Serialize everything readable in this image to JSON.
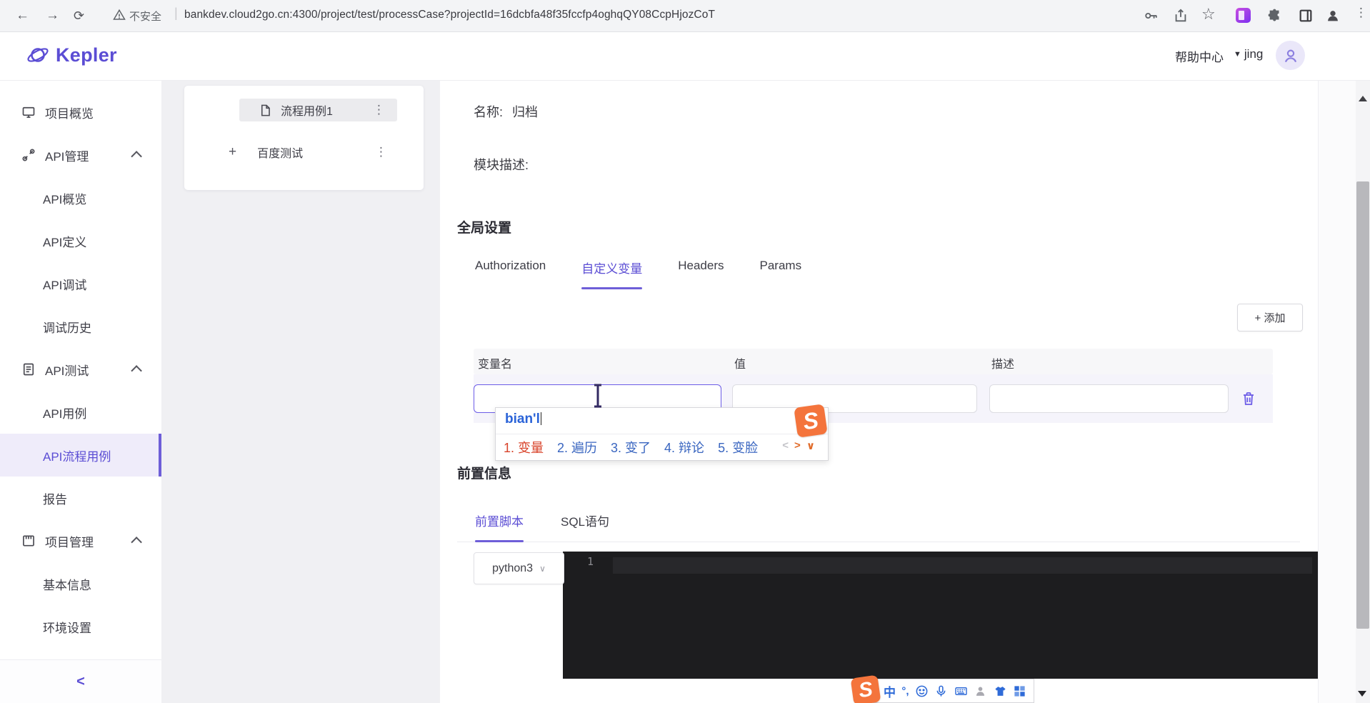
{
  "browser": {
    "security_warning": "不安全",
    "url": "bankdev.cloud2go.cn:4300/project/test/processCase?projectId=16dcbfa48f35fccfp4oghqQY08CcpHjozCoT"
  },
  "header": {
    "brand": "Kepler",
    "help_center": "帮助中心",
    "username": "jing"
  },
  "sidebar": {
    "items": [
      {
        "label": "项目概览"
      },
      {
        "label": "API管理"
      },
      {
        "label": "API概览"
      },
      {
        "label": "API定义"
      },
      {
        "label": "API调试"
      },
      {
        "label": "调试历史"
      },
      {
        "label": "API测试"
      },
      {
        "label": "API用例"
      },
      {
        "label": "API流程用例"
      },
      {
        "label": "报告"
      },
      {
        "label": "项目管理"
      },
      {
        "label": "基本信息"
      },
      {
        "label": "环境设置"
      }
    ],
    "collapse_label": "<"
  },
  "tree": {
    "items": [
      {
        "label": "流程用例1"
      },
      {
        "label": "百度测试"
      }
    ]
  },
  "form": {
    "name_label": "名称:",
    "name_value": "归档",
    "module_desc_label": "模块描述:"
  },
  "global_settings": {
    "title": "全局设置",
    "tabs": [
      "Authorization",
      "自定义变量",
      "Headers",
      "Params"
    ],
    "add_button": "+ 添加",
    "table_headers": [
      "变量名",
      "值",
      "描述"
    ]
  },
  "ime": {
    "composition": "bian'l",
    "candidates": [
      "1. 变量",
      "2. 遍历",
      "3. 变了",
      "4. 辩论",
      "5. 变脸"
    ]
  },
  "pre_info": {
    "title": "前置信息",
    "tabs": [
      "前置脚本",
      "SQL语句"
    ],
    "language": "python3",
    "editor_line_number": "1"
  },
  "icons": {
    "back": "←",
    "forward": "→",
    "reload": "⟳",
    "url_divider": "|",
    "star": "☆",
    "more_vert": "⋮",
    "menu_dots": "⋮",
    "caret_down": "▼",
    "expand_plus": "+",
    "chevron_down": "∨",
    "cand_prev": "<",
    "cand_next": ">",
    "cand_expand": "∨",
    "ime_mode": "中",
    "ime_punct": "°,",
    "sogou_s": "S"
  },
  "colors": {
    "brand_purple": "#5b4dd4",
    "active_item_bg": "#efecfa",
    "focus_border": "#6c5ce7",
    "sogou_orange": "#f4743c",
    "candidate_blue": "#3a66c0",
    "candidate_first_red": "#d8432a",
    "editor_bg": "#1d1d1f"
  }
}
